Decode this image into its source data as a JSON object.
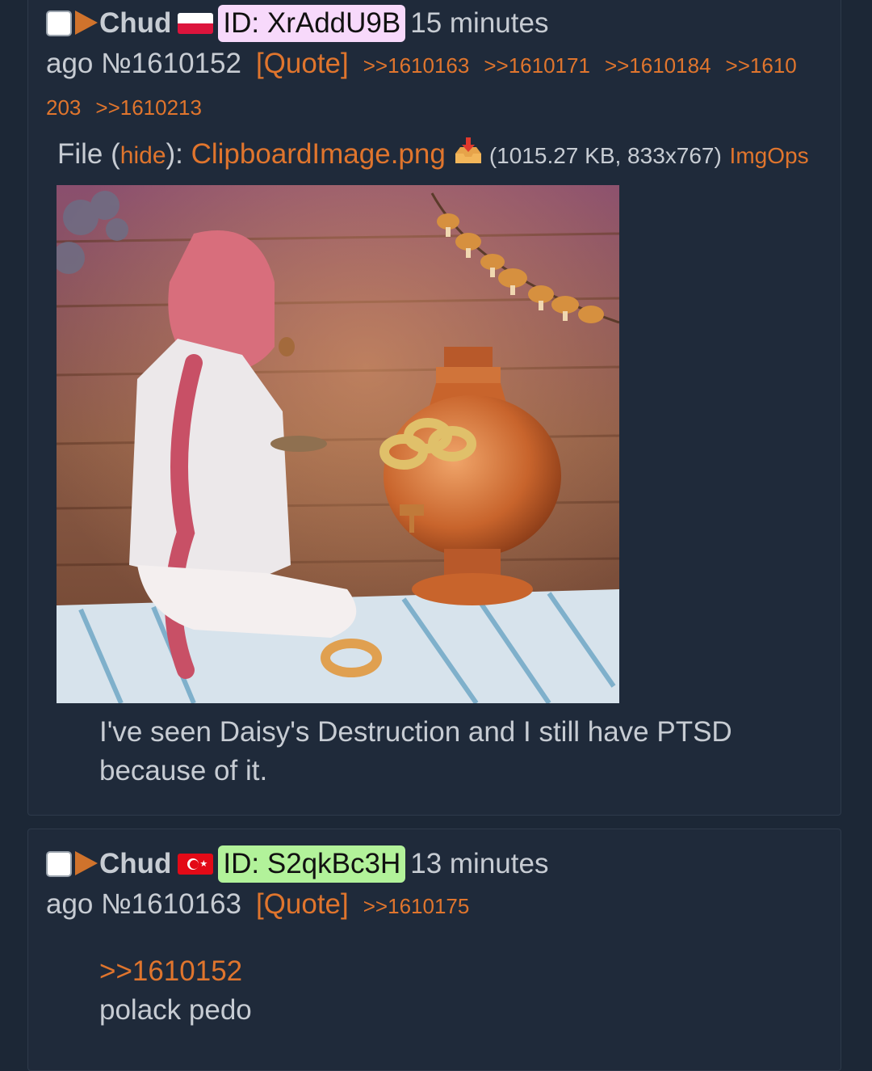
{
  "posts": [
    {
      "name": "Chud",
      "flag": "poland-flag-icon",
      "id_label": "ID: XrAddU9B",
      "id_color": "#f7d9fb",
      "time_part1": "15 minutes",
      "time_part2": "ago",
      "post_no": "№1610152",
      "quote_label": "[Quote]",
      "replies": [
        ">>1610163",
        ">>1610171",
        ">>1610184",
        ">>1610",
        "203",
        ">>1610213"
      ],
      "file": {
        "prefix": "File (",
        "hide_label": "hide",
        "suffix": "): ",
        "filename": "ClipboardImage.png",
        "meta": "(1015.27 KB, 833x767)",
        "imgops": "ImgOps"
      },
      "comment_lines": [
        "I've seen Daisy's Destruction and I still have PTSD",
        "because of it."
      ]
    },
    {
      "name": "Chud",
      "flag": "turkey-flag-icon",
      "id_label": "ID: S2qkBc3H",
      "id_color": "#b2f29a",
      "time_part1": "13 minutes",
      "time_part2": "ago",
      "post_no": "№1610163",
      "quote_label": "[Quote]",
      "replies": [
        ">>1610175"
      ],
      "quotelink": ">>1610152",
      "comment_lines": [
        "polack pedo"
      ]
    }
  ],
  "colors": {
    "background": "#1c2736",
    "post_bg": "#1f2a3a",
    "accent": "#e0752d",
    "text": "#c7ccd3"
  }
}
